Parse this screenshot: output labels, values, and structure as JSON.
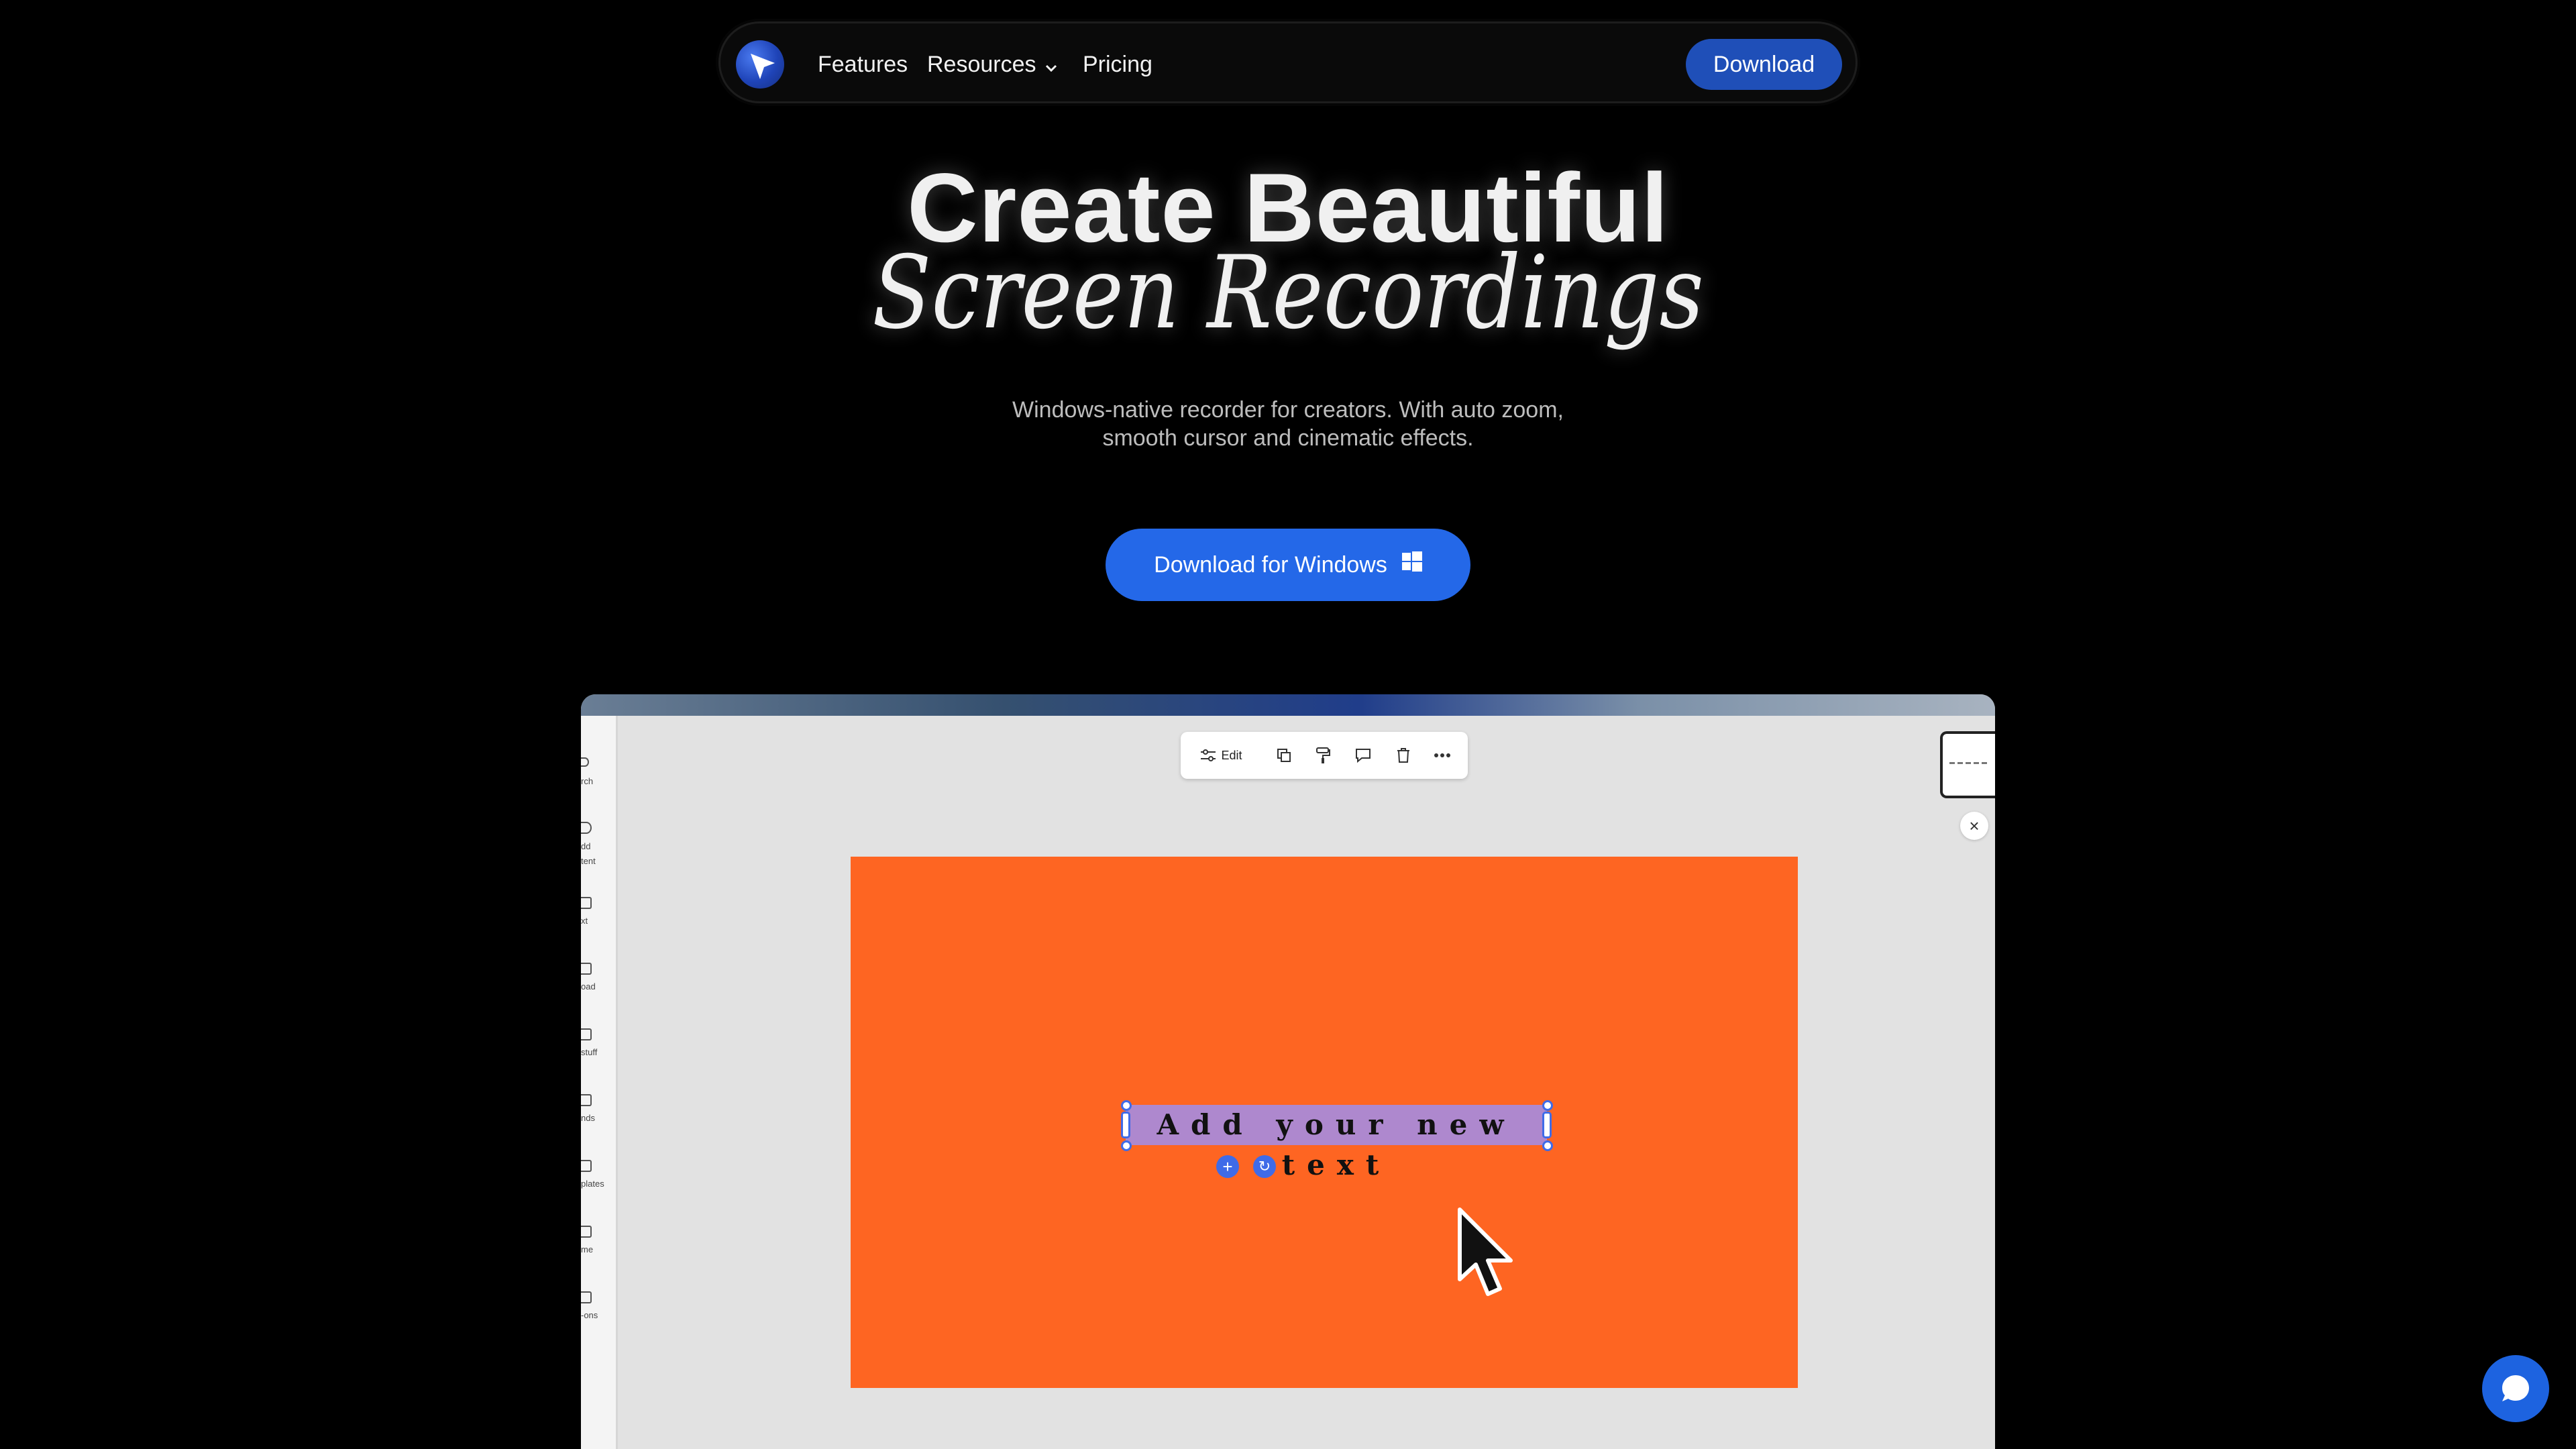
{
  "nav": {
    "links": [
      "Features",
      "Resources",
      "Pricing"
    ],
    "download_label": "Download"
  },
  "hero": {
    "title_line1": "Create Beautiful",
    "title_line2": "Screen Recordings",
    "subtitle_line1": "Windows-native recorder for creators. With auto zoom,",
    "subtitle_line2": "smooth cursor and cinematic effects.",
    "cta_label": "Download for Windows"
  },
  "preview": {
    "toolbar": {
      "edit_label": "Edit"
    },
    "sidebar_labels": [
      "rch",
      "dd\ntent",
      "xt",
      "oad",
      "stuff",
      "nds",
      "plates",
      "me",
      "-ons"
    ],
    "canvas_text": "Add your new text",
    "colors": {
      "canvas": "#fe6522",
      "selection": "#a58ce1",
      "accent": "#3f6be8"
    }
  },
  "colors": {
    "brand": "#2468e8",
    "nav_button": "#1f4fb8",
    "background": "#000000"
  }
}
